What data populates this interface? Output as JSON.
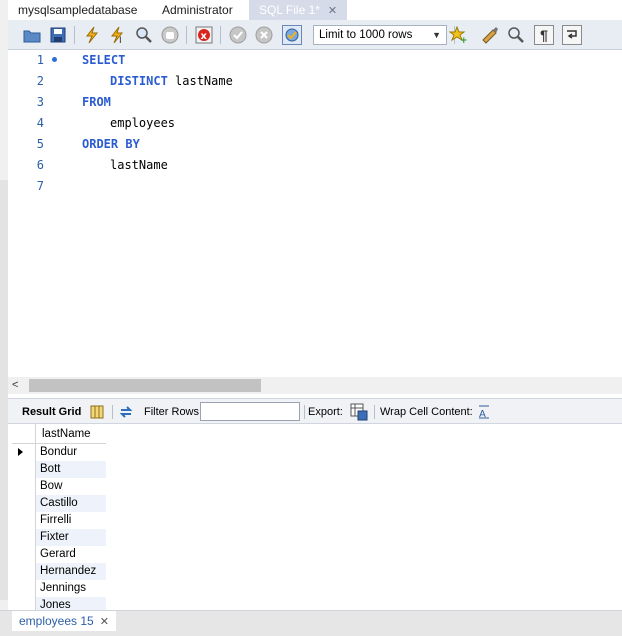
{
  "tabs": [
    {
      "label": "mysqlsampledatabase",
      "active": false
    },
    {
      "label": "Administrator",
      "active": false
    },
    {
      "label": "SQL File 1*",
      "active": true
    }
  ],
  "tab_close_glyph": "✕",
  "toolbar": {
    "icons": [
      "open-folder-icon",
      "save-icon",
      "execute-icon",
      "execute-current-icon",
      "explain-icon",
      "stop-icon",
      "toggle-error-icon",
      "commit-icon",
      "rollback-icon",
      "autocommit-icon",
      "bookmark-icon",
      "beautify-icon",
      "find-icon",
      "invisible-chars-icon",
      "wrap-icon"
    ],
    "limit_label": "Limit to 1000 rows"
  },
  "editor": {
    "lines": [
      {
        "num": "1",
        "keyword": "SELECT",
        "text": "",
        "indent": 0
      },
      {
        "num": "2",
        "keyword": "DISTINCT",
        "text": " lastName",
        "indent": 1
      },
      {
        "num": "3",
        "keyword": "FROM",
        "text": "",
        "indent": 0
      },
      {
        "num": "4",
        "keyword": "",
        "text": "employees",
        "indent": 1
      },
      {
        "num": "5",
        "keyword": "ORDER BY",
        "text": "",
        "indent": 0
      },
      {
        "num": "6",
        "keyword": "",
        "text": "lastName",
        "indent": 1
      },
      {
        "num": "7",
        "keyword": "",
        "text": "",
        "indent": 0
      }
    ]
  },
  "results": {
    "result_grid_label": "Result Grid",
    "filter_label": "Filter Rows:",
    "filter_value": "",
    "export_label": "Export:",
    "wrap_label": "Wrap Cell Content:",
    "columns": [
      "lastName"
    ],
    "rows": [
      "Bondur",
      "Bott",
      "Bow",
      "Castillo",
      "Firrelli",
      "Fixter",
      "Gerard",
      "Hernandez",
      "Jennings",
      "Jones"
    ]
  },
  "bottom_tab": {
    "label": "employees 15",
    "close": "✕"
  },
  "colors": {
    "keyword": "#2a5cd0",
    "line_number": "#2c5ea8",
    "active_tab": "#d6dbe9",
    "toolbar": "#e8ecf3"
  }
}
